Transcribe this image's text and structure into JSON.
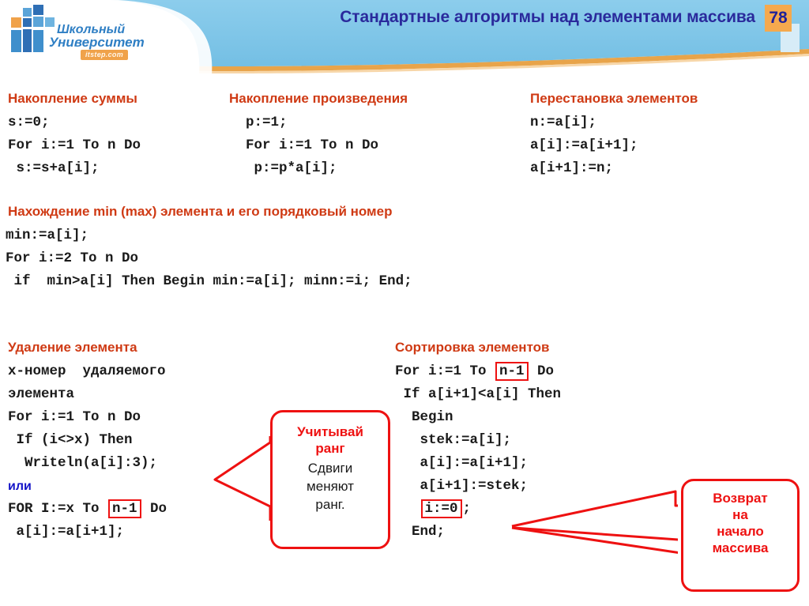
{
  "header": {
    "title": "Стандартные алгоритмы над элементами массива",
    "page_number": "78",
    "banner_color": "#7ec6e8",
    "banner_edge_color": "#e8a44a",
    "title_color": "#2a2a9c",
    "badge_color": "#f5a94e"
  },
  "logo": {
    "line1": "Школьный",
    "line2": "Университет",
    "badge": "itstep.com",
    "blue": "#3f8fcc",
    "orange": "#f0a24a"
  },
  "accent": {
    "heading_color": "#cf3a14",
    "callout_color": "#ee1111",
    "or_color": "#1414c8"
  },
  "sections": {
    "sum": {
      "heading": "Накопление суммы",
      "code": "s:=0;\nFor i:=1 To n Do\n s:=s+a[i];"
    },
    "product": {
      "heading": "Накопление произведения",
      "code": "  p:=1;\n  For i:=1 To n Do\n   p:=p*a[i];"
    },
    "swap": {
      "heading": "Перестановка элементов",
      "code": "n:=a[i];\na[i]:=a[i+1];\na[i+1]:=n;"
    },
    "minmax": {
      "heading": "Нахождение  min (max) элемента и его порядковый номер",
      "code": "min:=a[i];\nFor i:=2 To n Do\n if  min>a[i] Then Begin min:=a[i]; minn:=i; End;"
    },
    "delete": {
      "heading": "Удаление элемента",
      "line1": "x-номер  удаляемого",
      "line2": "элемента",
      "line3": "For i:=1 To n Do",
      "line4": " If (i<>x) Then",
      "line5": "  Writeln(a[i]:3);",
      "or_label": "или",
      "line6_a": "FOR I:=x To ",
      "line6_box": "n-1",
      "line6_b": " Do",
      "line7": " a[i]:=a[i+1];"
    },
    "sort": {
      "heading": "Сортировка элементов",
      "line1_a": "For i:=1 To ",
      "line1_box": "n-1",
      "line1_b": " Do",
      "line2": " If a[i+1]<a[i] Then",
      "line3": "  Begin",
      "line4": "   stek:=a[i];",
      "line5": "   a[i]:=a[i+1];",
      "line6": "   a[i+1]:=stek;",
      "line7_box": "i:=0",
      "line7_tail": ";",
      "line8": "  End;"
    }
  },
  "callouts": {
    "rank": {
      "title_line1": "Учитывай",
      "title_line2": "ранг",
      "body_line1": "Сдвиги",
      "body_line2": "меняют",
      "body_line3": "ранг."
    },
    "return": {
      "line1": "Возврат",
      "line2": "на",
      "line3": "начало",
      "line4": "массива"
    }
  }
}
